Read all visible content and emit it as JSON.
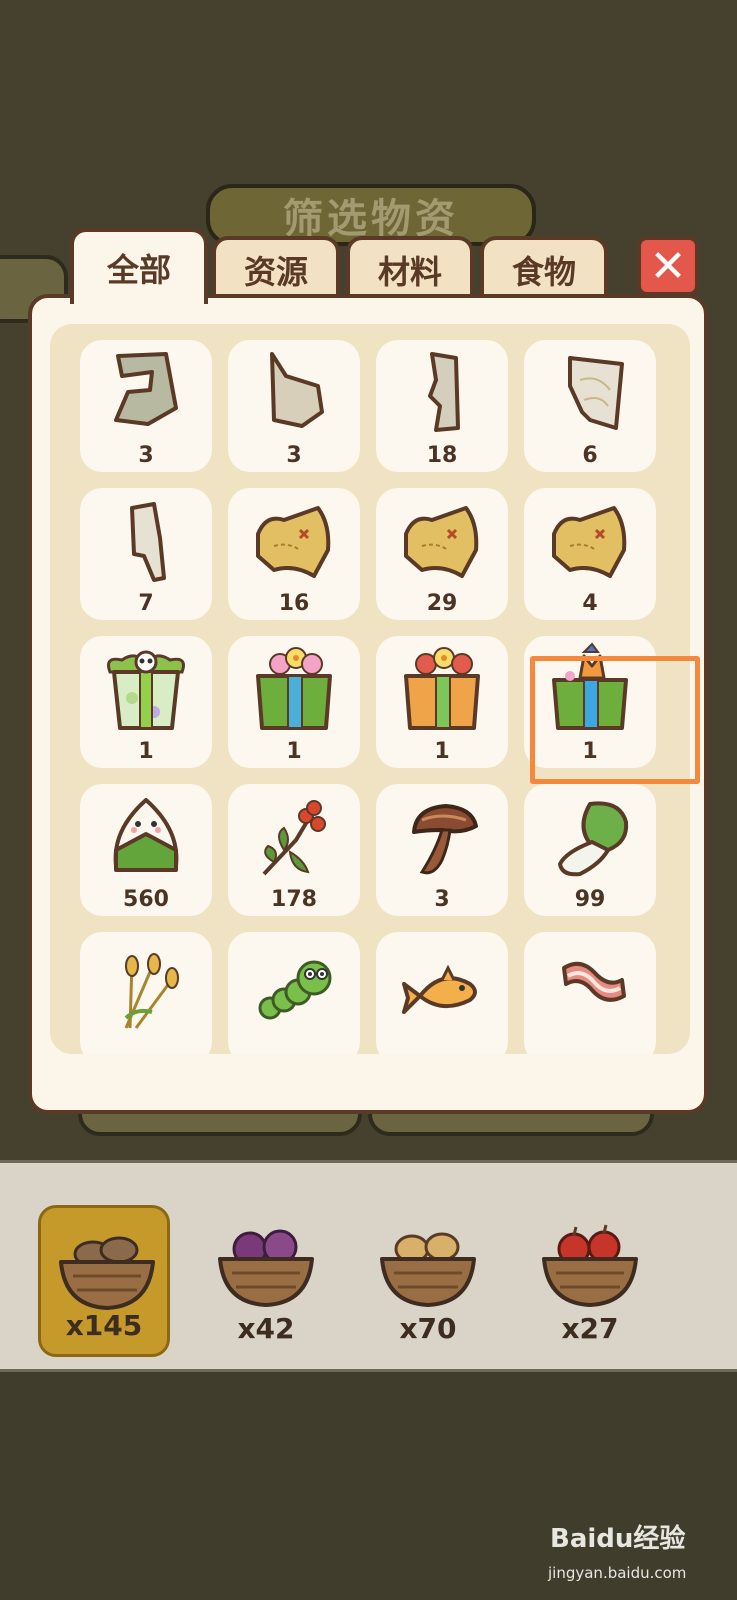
{
  "title": "筛选物资",
  "tabs": [
    {
      "label": "全部",
      "active": true
    },
    {
      "label": "资源",
      "active": false
    },
    {
      "label": "材料",
      "active": false
    },
    {
      "label": "食物",
      "active": false
    }
  ],
  "close_icon": "close-x-icon",
  "items": [
    {
      "icon": "map-fragment-icon",
      "count": "3"
    },
    {
      "icon": "map-fragment-icon",
      "count": "3"
    },
    {
      "icon": "map-fragment-icon",
      "count": "18"
    },
    {
      "icon": "map-fragment-icon",
      "count": "6"
    },
    {
      "icon": "map-fragment-icon",
      "count": "7"
    },
    {
      "icon": "treasure-map-icon",
      "count": "16"
    },
    {
      "icon": "treasure-map-icon",
      "count": "29"
    },
    {
      "icon": "treasure-map-icon",
      "count": "4"
    },
    {
      "icon": "gift-box-panda-icon",
      "count": "1"
    },
    {
      "icon": "gift-box-green-icon",
      "count": "1"
    },
    {
      "icon": "gift-box-orange-icon",
      "count": "1"
    },
    {
      "icon": "gift-box-fox-icon",
      "count": "1"
    },
    {
      "icon": "rice-dumpling-icon",
      "count": "560"
    },
    {
      "icon": "berry-branch-icon",
      "count": "178"
    },
    {
      "icon": "mushroom-icon",
      "count": "3"
    },
    {
      "icon": "bok-choy-icon",
      "count": "99"
    },
    {
      "icon": "wheat-icon",
      "count": ""
    },
    {
      "icon": "caterpillar-icon",
      "count": ""
    },
    {
      "icon": "fish-icon",
      "count": ""
    },
    {
      "icon": "bacon-icon",
      "count": ""
    }
  ],
  "baskets": [
    {
      "icon": "potato-basket-icon",
      "qty": "x145",
      "selected": true
    },
    {
      "icon": "purple-cabbage-basket-icon",
      "qty": "x42",
      "selected": false
    },
    {
      "icon": "taro-basket-icon",
      "qty": "x70",
      "selected": false
    },
    {
      "icon": "apple-basket-icon",
      "qty": "x27",
      "selected": false
    }
  ],
  "watermark": {
    "brand": "Baidu经验",
    "url": "jingyan.baidu.com"
  },
  "colors": {
    "highlight": "#f4883c",
    "close": "#e4574b",
    "outline": "#5a3a26"
  }
}
